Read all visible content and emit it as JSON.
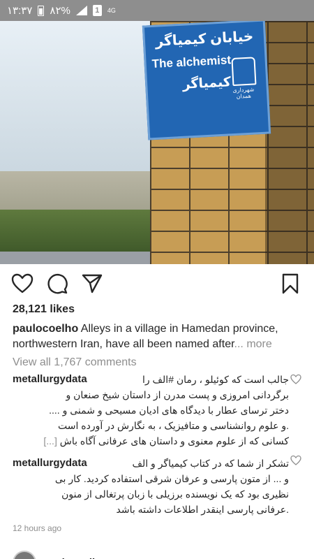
{
  "status_bar": {
    "time": "۱۳:۳۷",
    "battery": "۸۲%",
    "sim": "1",
    "network": "4G"
  },
  "photo": {
    "sign_farsi_top": "خیابان کیمیاگر",
    "sign_english": "The alchemist",
    "sign_farsi_bottom": "کیمیاگر",
    "sign_emblem_caption": "شهرداری همدان"
  },
  "post": {
    "likes": "28,121 likes",
    "caption_user": "paulocoelho",
    "caption_text": " Alleys in a village in Hamedan province, northwestern Iran, have all been named after",
    "caption_more": "... more",
    "view_all_comments": "View all 1,767 comments",
    "time_ago": "12 hours ago"
  },
  "comments": [
    {
      "user": "metallurgydata",
      "first_line": "جالب است که کوئیلو ، رمان #الف را",
      "lines": [
        "برگردانی امروزی و پست مدرن از داستان شیخ صنعان و",
        "دختر ترسای عطار با دیدگاه های ادیان مسیحی و شمنی و ....",
        ".و علوم روانشناسی و متافیزیک ، به نگارش در آورده است",
        "کسانی که از علوم معنوی و داستان های عرفانی آگاه باش"
      ],
      "expand": "[...]"
    },
    {
      "user": "metallurgydata",
      "first_line": "تشکر از شما که در کتاب کیمیاگر و الف",
      "lines": [
        "و ... از متون پارسی و عرفان شرقی استفاده کردید. کار بی",
        "نظیری بود که یک نویسنده برزیلی با زبان پرتغالی از منون",
        ".عرفانی پارسی اینقدر اطلاعات داشته باشد"
      ]
    }
  ],
  "next_post": {
    "user": "paulocoelho"
  }
}
